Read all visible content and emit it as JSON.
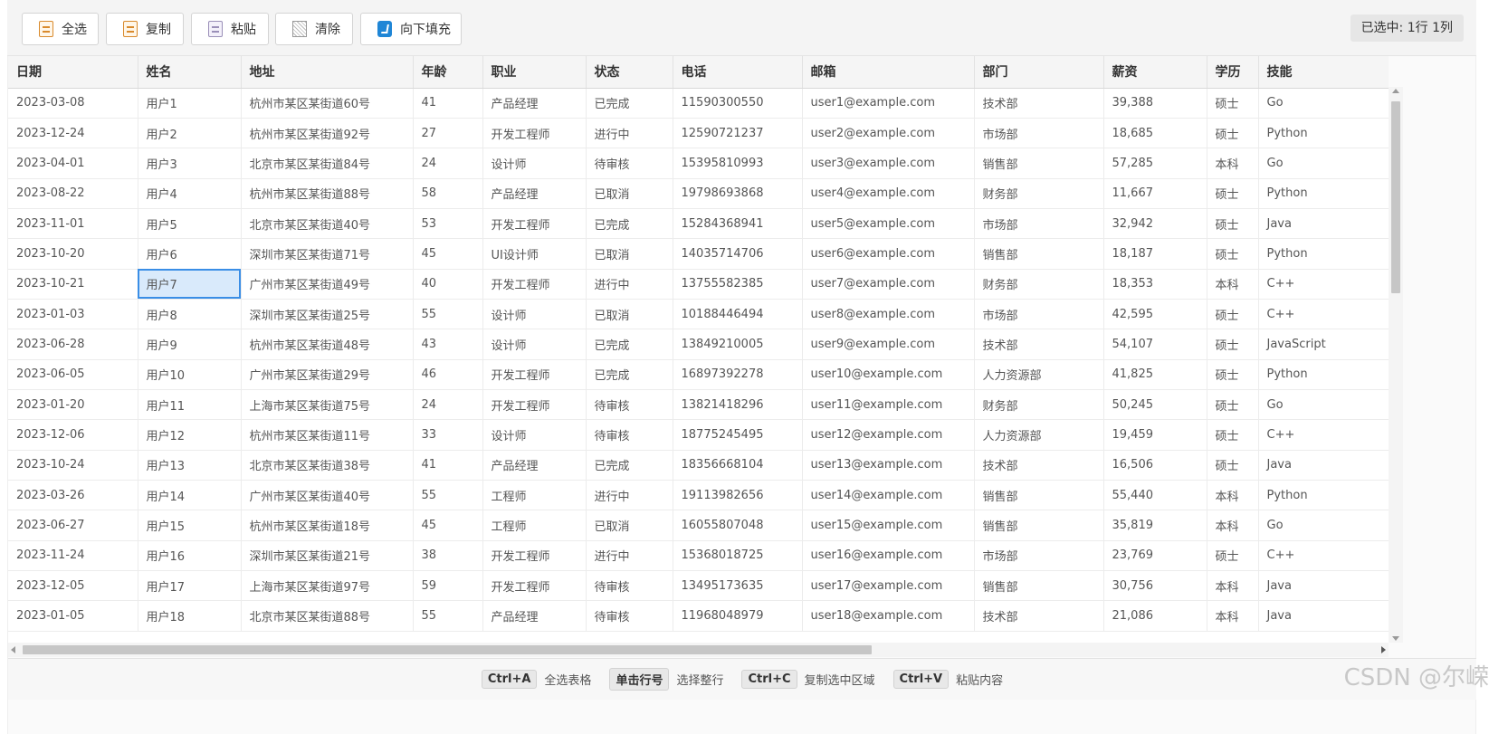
{
  "toolbar": {
    "buttons": [
      {
        "label": "全选",
        "icon": "select-all-icon"
      },
      {
        "label": "复制",
        "icon": "copy-icon"
      },
      {
        "label": "粘贴",
        "icon": "paste-icon"
      },
      {
        "label": "清除",
        "icon": "clear-icon"
      },
      {
        "label": "向下填充",
        "icon": "fill-down-icon"
      }
    ],
    "selection_info": "已选中: 1行 1列"
  },
  "table": {
    "columns": [
      "日期",
      "姓名",
      "地址",
      "年龄",
      "职业",
      "状态",
      "电话",
      "邮箱",
      "部门",
      "薪资",
      "学历",
      "技能"
    ],
    "selected_cell": {
      "row": 6,
      "col": 1
    },
    "rows": [
      [
        "2023-03-08",
        "用户1",
        "杭州市某区某街道60号",
        "41",
        "产品经理",
        "已完成",
        "11590300550",
        "user1@example.com",
        "技术部",
        "39,388",
        "硕士",
        "Go"
      ],
      [
        "2023-12-24",
        "用户2",
        "杭州市某区某街道92号",
        "27",
        "开发工程师",
        "进行中",
        "12590721237",
        "user2@example.com",
        "市场部",
        "18,685",
        "硕士",
        "Python"
      ],
      [
        "2023-04-01",
        "用户3",
        "北京市某区某街道84号",
        "24",
        "设计师",
        "待审核",
        "15395810993",
        "user3@example.com",
        "销售部",
        "57,285",
        "本科",
        "Go"
      ],
      [
        "2023-08-22",
        "用户4",
        "杭州市某区某街道88号",
        "58",
        "产品经理",
        "已取消",
        "19798693868",
        "user4@example.com",
        "财务部",
        "11,667",
        "硕士",
        "Python"
      ],
      [
        "2023-11-01",
        "用户5",
        "北京市某区某街道40号",
        "53",
        "开发工程师",
        "已完成",
        "15284368941",
        "user5@example.com",
        "市场部",
        "32,942",
        "硕士",
        "Java"
      ],
      [
        "2023-10-20",
        "用户6",
        "深圳市某区某街道71号",
        "45",
        "UI设计师",
        "已取消",
        "14035714706",
        "user6@example.com",
        "销售部",
        "18,187",
        "硕士",
        "Python"
      ],
      [
        "2023-10-21",
        "用户7",
        "广州市某区某街道49号",
        "40",
        "开发工程师",
        "进行中",
        "13755582385",
        "user7@example.com",
        "财务部",
        "18,353",
        "本科",
        "C++"
      ],
      [
        "2023-01-03",
        "用户8",
        "深圳市某区某街道25号",
        "55",
        "设计师",
        "已取消",
        "10188446494",
        "user8@example.com",
        "市场部",
        "42,595",
        "硕士",
        "C++"
      ],
      [
        "2023-06-28",
        "用户9",
        "杭州市某区某街道48号",
        "43",
        "设计师",
        "已完成",
        "13849210005",
        "user9@example.com",
        "技术部",
        "54,107",
        "硕士",
        "JavaScript"
      ],
      [
        "2023-06-05",
        "用户10",
        "广州市某区某街道29号",
        "46",
        "开发工程师",
        "已完成",
        "16897392278",
        "user10@example.com",
        "人力资源部",
        "41,825",
        "硕士",
        "Python"
      ],
      [
        "2023-01-20",
        "用户11",
        "上海市某区某街道75号",
        "24",
        "开发工程师",
        "待审核",
        "13821418296",
        "user11@example.com",
        "财务部",
        "50,245",
        "硕士",
        "Go"
      ],
      [
        "2023-12-06",
        "用户12",
        "杭州市某区某街道11号",
        "33",
        "设计师",
        "待审核",
        "18775245495",
        "user12@example.com",
        "人力资源部",
        "19,459",
        "硕士",
        "C++"
      ],
      [
        "2023-10-24",
        "用户13",
        "北京市某区某街道38号",
        "41",
        "产品经理",
        "已完成",
        "18356668104",
        "user13@example.com",
        "技术部",
        "16,506",
        "硕士",
        "Java"
      ],
      [
        "2023-03-26",
        "用户14",
        "广州市某区某街道40号",
        "55",
        "工程师",
        "进行中",
        "19113982656",
        "user14@example.com",
        "销售部",
        "55,440",
        "本科",
        "Python"
      ],
      [
        "2023-06-27",
        "用户15",
        "杭州市某区某街道18号",
        "45",
        "工程师",
        "已取消",
        "16055807048",
        "user15@example.com",
        "销售部",
        "35,819",
        "本科",
        "Go"
      ],
      [
        "2023-11-24",
        "用户16",
        "深圳市某区某街道21号",
        "38",
        "开发工程师",
        "进行中",
        "15368018725",
        "user16@example.com",
        "市场部",
        "23,769",
        "硕士",
        "C++"
      ],
      [
        "2023-12-05",
        "用户17",
        "上海市某区某街道97号",
        "59",
        "开发工程师",
        "待审核",
        "13495173635",
        "user17@example.com",
        "销售部",
        "30,756",
        "本科",
        "Java"
      ],
      [
        "2023-01-05",
        "用户18",
        "北京市某区某街道88号",
        "55",
        "产品经理",
        "待审核",
        "11968048979",
        "user18@example.com",
        "技术部",
        "21,086",
        "本科",
        "Java"
      ]
    ]
  },
  "footer": {
    "hints": [
      {
        "key": "Ctrl+A",
        "text": "全选表格"
      },
      {
        "key": "单击行号",
        "text": "选择整行"
      },
      {
        "key": "Ctrl+C",
        "text": "复制选中区域"
      },
      {
        "key": "Ctrl+V",
        "text": "粘贴内容"
      }
    ]
  },
  "watermark": "CSDN @尔嵘",
  "colors": {
    "selection_fill": "#d9eafb",
    "selection_border": "#3a8ee6",
    "fill_icon": "#1f86d6"
  }
}
